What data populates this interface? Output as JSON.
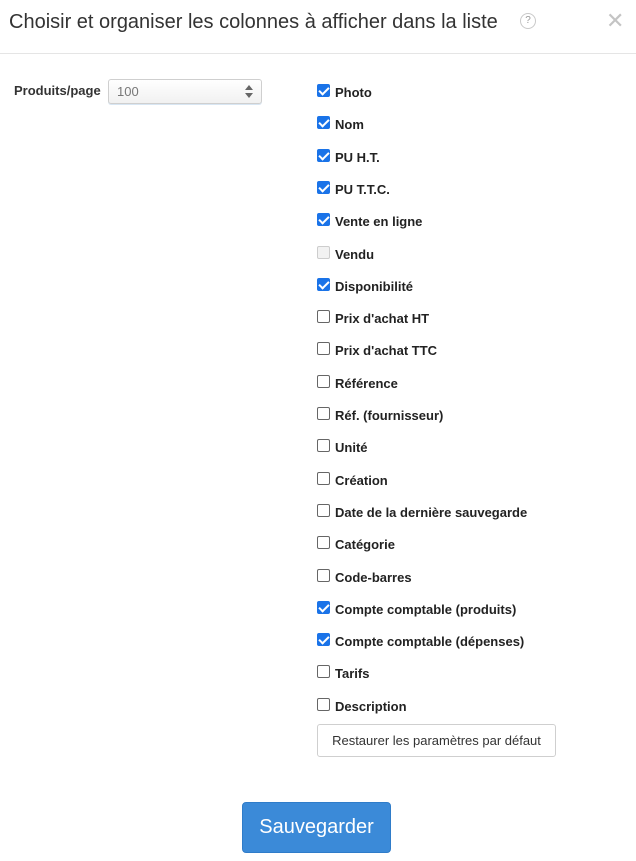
{
  "dialog": {
    "title": "Choisir et organiser les colonnes à afficher dans la liste",
    "help_glyph": "?",
    "close_glyph": "✕"
  },
  "per_page": {
    "label": "Produits/page",
    "value": "100"
  },
  "columns": [
    {
      "label": "Photo",
      "checked": true
    },
    {
      "label": "Nom",
      "checked": true
    },
    {
      "label": "PU H.T.",
      "checked": true
    },
    {
      "label": "PU T.T.C.",
      "checked": true
    },
    {
      "label": "Vente en ligne",
      "checked": true
    },
    {
      "label": "Vendu",
      "checked": false,
      "disabled": true
    },
    {
      "label": "Disponibilité",
      "checked": true
    },
    {
      "label": "Prix d'achat HT",
      "checked": false
    },
    {
      "label": "Prix d'achat TTC",
      "checked": false
    },
    {
      "label": "Référence",
      "checked": false
    },
    {
      "label": "Réf. (fournisseur)",
      "checked": false
    },
    {
      "label": "Unité",
      "checked": false
    },
    {
      "label": "Création",
      "checked": false
    },
    {
      "label": "Date de la dernière sauvegarde",
      "checked": false
    },
    {
      "label": "Catégorie",
      "checked": false
    },
    {
      "label": "Code-barres",
      "checked": false
    },
    {
      "label": "Compte comptable (produits)",
      "checked": true
    },
    {
      "label": "Compte comptable (dépenses)",
      "checked": true
    },
    {
      "label": "Tarifs",
      "checked": false
    },
    {
      "label": "Description",
      "checked": false
    }
  ],
  "buttons": {
    "restore_label": "Restaurer les paramètres par défaut",
    "save_label": "Sauvegarder"
  },
  "colors": {
    "accent": "#1a73e8",
    "save_button": "#3b8ad8"
  }
}
